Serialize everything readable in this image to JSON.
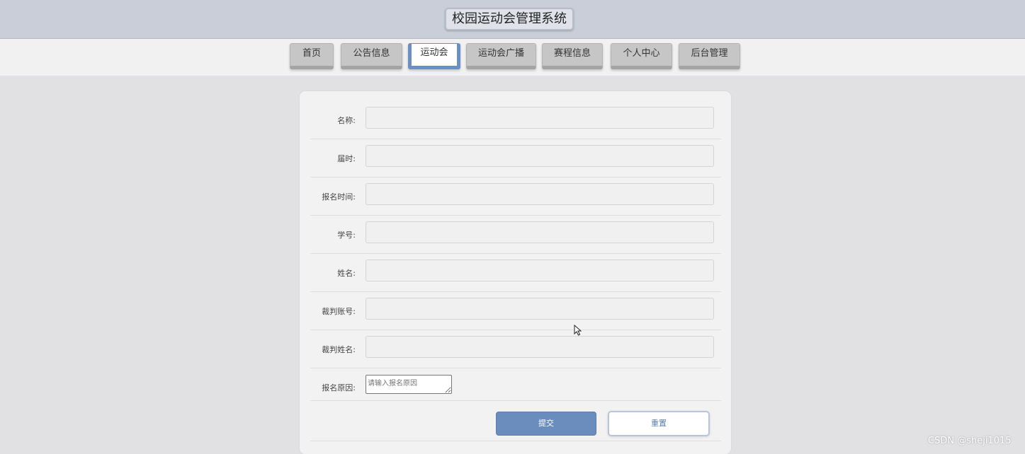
{
  "app": {
    "title": "校园运动会管理系统"
  },
  "nav": {
    "tabs": [
      {
        "label": "首页"
      },
      {
        "label": "公告信息"
      },
      {
        "label": "运动会",
        "active": true
      },
      {
        "label": "运动会广播"
      },
      {
        "label": "赛程信息"
      },
      {
        "label": "个人中心"
      },
      {
        "label": "后台管理"
      }
    ]
  },
  "form": {
    "fields": [
      {
        "label": "名称:",
        "value": ""
      },
      {
        "label": "届时:",
        "value": ""
      },
      {
        "label": "报名时间:",
        "value": ""
      },
      {
        "label": "学号:",
        "value": ""
      },
      {
        "label": "姓名:",
        "value": ""
      },
      {
        "label": "裁判账号:",
        "value": ""
      },
      {
        "label": "裁判姓名:",
        "value": ""
      }
    ],
    "reason": {
      "label": "报名原因:",
      "placeholder": "请输入报名原因"
    },
    "submit_label": "提交",
    "reset_label": "重置"
  },
  "watermark": "CSDN @sheji1015",
  "colors": {
    "header_bg": "#c9ced9",
    "accent": "#6a8dbd",
    "active_tab_border": "#6a8fc5",
    "page_bg": "#e1e1e3"
  }
}
